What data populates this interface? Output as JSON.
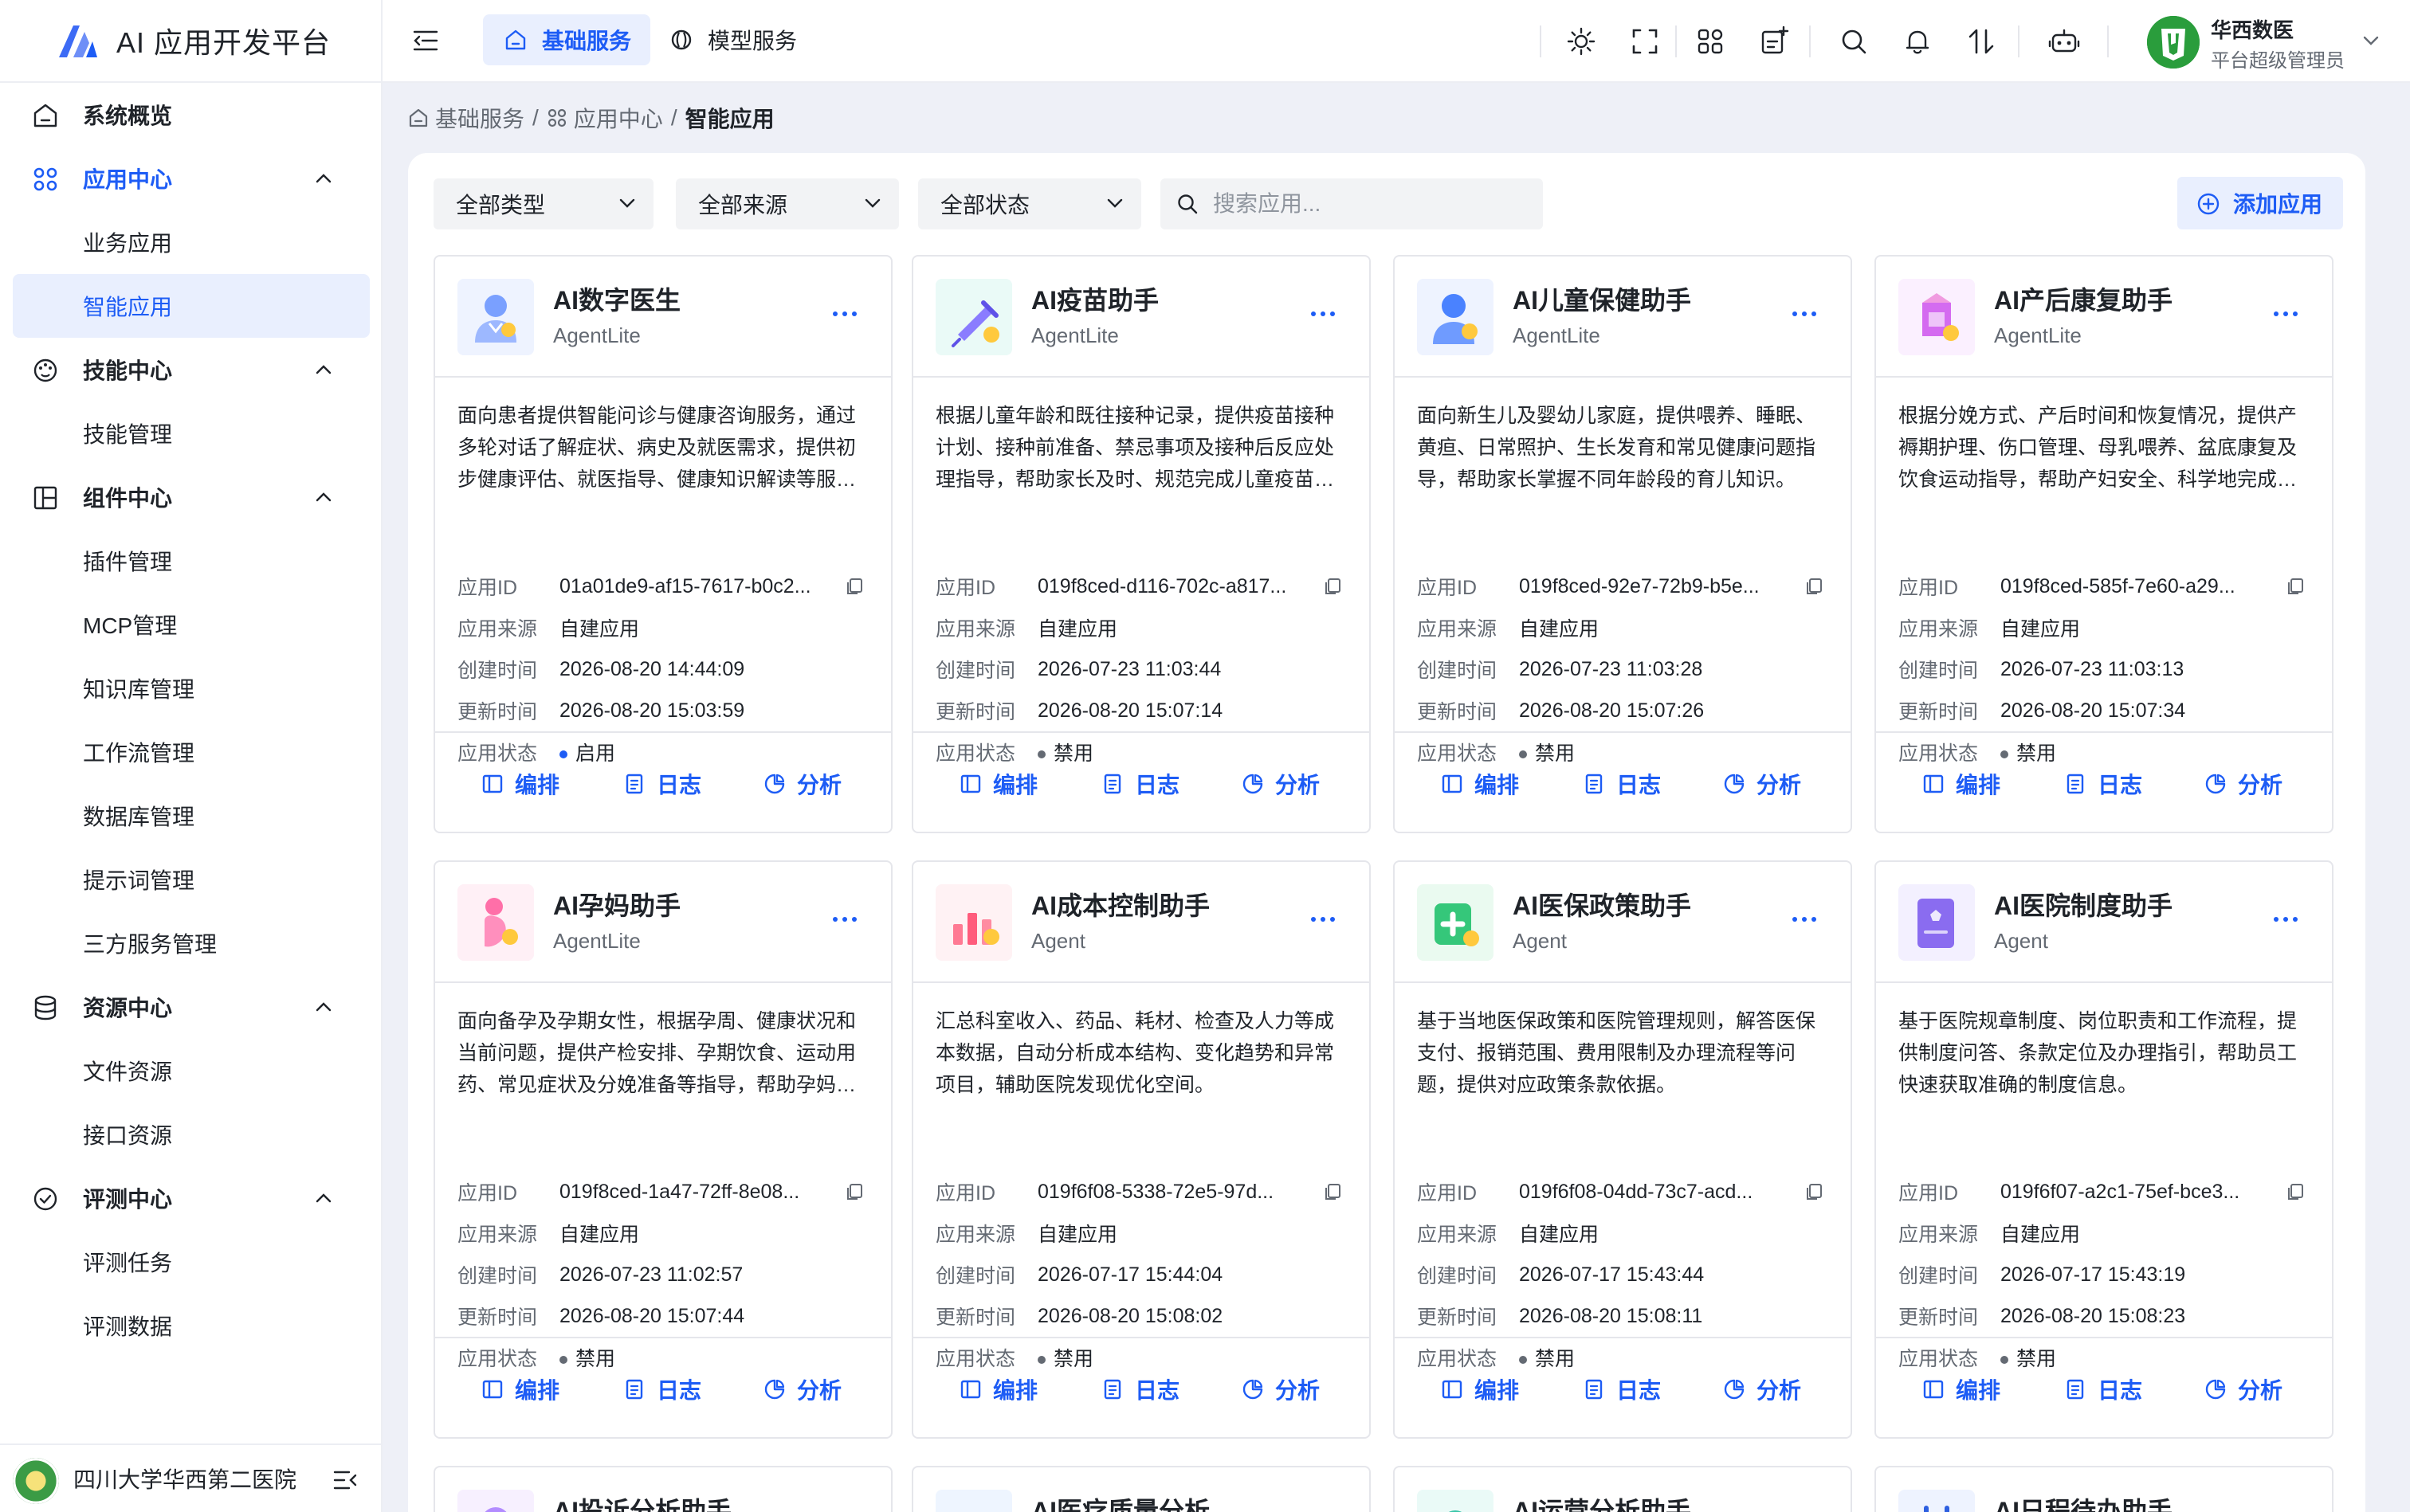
{
  "app": {
    "title": "AI 应用开发平台",
    "accent": "#1d5cf5"
  },
  "sidebar": {
    "groups": [
      {
        "label": "系统概览",
        "icon": "home-icon",
        "expanded": false,
        "items": []
      },
      {
        "label": "应用中心",
        "icon": "grid-icon",
        "expanded": true,
        "active": true,
        "items": [
          {
            "label": "业务应用"
          },
          {
            "label": "智能应用",
            "active": true
          }
        ]
      },
      {
        "label": "技能中心",
        "icon": "palette-icon",
        "expanded": true,
        "items": [
          {
            "label": "技能管理"
          }
        ]
      },
      {
        "label": "组件中心",
        "icon": "layout-icon",
        "expanded": true,
        "items": [
          {
            "label": "插件管理"
          },
          {
            "label": "MCP管理"
          },
          {
            "label": "知识库管理"
          },
          {
            "label": "工作流管理"
          },
          {
            "label": "数据库管理"
          },
          {
            "label": "提示词管理"
          },
          {
            "label": "三方服务管理"
          }
        ]
      },
      {
        "label": "资源中心",
        "icon": "database-icon",
        "expanded": true,
        "items": [
          {
            "label": "文件资源"
          },
          {
            "label": "接口资源"
          }
        ]
      },
      {
        "label": "评测中心",
        "icon": "check-circle-icon",
        "expanded": true,
        "items": [
          {
            "label": "评测任务"
          },
          {
            "label": "评测数据"
          }
        ]
      }
    ],
    "footer": {
      "org_name": "四川大学华西第二医院"
    }
  },
  "header": {
    "tabs": [
      {
        "label": "基础服务",
        "active": true
      },
      {
        "label": "模型服务",
        "active": false
      }
    ],
    "icons": [
      "sun-icon",
      "fullscreen-icon",
      "apps-icon",
      "note-add-icon",
      "search-icon",
      "bell-icon",
      "sort-icon",
      "robot-icon"
    ],
    "user": {
      "name": "华西数医",
      "role": "平台超级管理员"
    }
  },
  "breadcrumb": {
    "items": [
      "基础服务",
      "应用中心"
    ],
    "current": "智能应用",
    "separator": "/"
  },
  "toolbar": {
    "filters": [
      "全部类型",
      "全部来源",
      "全部状态"
    ],
    "search_placeholder": "搜索应用...",
    "add_label": "添加应用"
  },
  "labels": {
    "id": "应用ID",
    "source": "应用来源",
    "created": "创建时间",
    "updated": "更新时间",
    "status": "应用状态",
    "edit": "编排",
    "log": "日志",
    "analyze": "分析"
  },
  "status_colors": {
    "启用": "#1d5cf5",
    "禁用": "#646a73"
  },
  "cards": [
    {
      "title": "AI数字医生",
      "type": "AgentLite",
      "icon": "doctor-icon",
      "desc": "面向患者提供智能问诊与健康咨询服务，通过多轮对话了解症状、病史及就医需求，提供初步健康评估、就医指导、健康知识解读等服务。",
      "id": "01a01de9-af15-7617-b0c2...",
      "source": "自建应用",
      "created": "2026-08-20 14:44:09",
      "updated": "2026-08-20 15:03:59",
      "status": "启用"
    },
    {
      "title": "AI疫苗助手",
      "type": "AgentLite",
      "icon": "vaccine-icon",
      "desc": "根据儿童年龄和既往接种记录，提供疫苗接种计划、接种前准备、禁忌事项及接种后反应处理指导，帮助家长及时、规范完成儿童疫苗接种。",
      "id": "019f8ced-d116-702c-a817...",
      "source": "自建应用",
      "created": "2026-07-23 11:03:44",
      "updated": "2026-08-20 15:07:14",
      "status": "禁用"
    },
    {
      "title": "AI儿童保健助手",
      "type": "AgentLite",
      "icon": "child-care-icon",
      "desc": "面向新生儿及婴幼儿家庭，提供喂养、睡眠、黄疸、日常照护、生长发育和常见健康问题指导，帮助家长掌握不同年龄段的育儿知识。",
      "id": "019f8ced-92e7-72b9-b5e...",
      "source": "自建应用",
      "created": "2026-07-23 11:03:28",
      "updated": "2026-08-20 15:07:26",
      "status": "禁用"
    },
    {
      "title": "AI产后康复助手",
      "type": "AgentLite",
      "icon": "postpartum-icon",
      "desc": "根据分娩方式、产后时间和恢复情况，提供产褥期护理、伤口管理、母乳喂养、盆底康复及饮食运动指导，帮助产妇安全、科学地完成产后康复。",
      "id": "019f8ced-585f-7e60-a29...",
      "source": "自建应用",
      "created": "2026-07-23 11:03:13",
      "updated": "2026-08-20 15:07:34",
      "status": "禁用"
    },
    {
      "title": "AI孕妈助手",
      "type": "AgentLite",
      "icon": "pregnancy-icon",
      "desc": "面向备孕及孕期女性，根据孕周、健康状况和当前问题，提供产检安排、孕期饮食、运动用药、常见症状及分娩准备等指导，帮助孕妈科学孕育。",
      "id": "019f8ced-1a47-72ff-8e08...",
      "source": "自建应用",
      "created": "2026-07-23 11:02:57",
      "updated": "2026-08-20 15:07:44",
      "status": "禁用"
    },
    {
      "title": "AI成本控制助手",
      "type": "Agent",
      "icon": "cost-chart-icon",
      "desc": "汇总科室收入、药品、耗材、检查及人力等成本数据，自动分析成本结构、变化趋势和异常项目，辅助医院发现优化空间。",
      "id": "019f6f08-5338-72e5-97d...",
      "source": "自建应用",
      "created": "2026-07-17 15:44:04",
      "updated": "2026-08-20 15:08:02",
      "status": "禁用"
    },
    {
      "title": "AI医保政策助手",
      "type": "Agent",
      "icon": "insurance-icon",
      "desc": "基于当地医保政策和医院管理规则，解答医保支付、报销范围、费用限制及办理流程等问题，提供对应政策条款依据。",
      "id": "019f6f08-04dd-73c7-acd...",
      "source": "自建应用",
      "created": "2026-07-17 15:43:44",
      "updated": "2026-08-20 15:08:11",
      "status": "禁用"
    },
    {
      "title": "AI医院制度助手",
      "type": "Agent",
      "icon": "rulebook-icon",
      "desc": "基于医院规章制度、岗位职责和工作流程，提供制度问答、条款定位及办理指引，帮助员工快速获取准确的制度信息。",
      "id": "019f6f07-a2c1-75ef-bce3...",
      "source": "自建应用",
      "created": "2026-07-17 15:43:19",
      "updated": "2026-08-20 15:08:23",
      "status": "禁用"
    }
  ],
  "partial_cards": [
    {
      "title": "AI投诉分析助手",
      "icon": "complaint-icon"
    },
    {
      "title": "AI医疗质量分析",
      "icon": "quality-icon"
    },
    {
      "title": "AI运营分析助手",
      "icon": "operation-icon"
    },
    {
      "title": "AI日程待办助手",
      "icon": "calendar-icon"
    }
  ]
}
